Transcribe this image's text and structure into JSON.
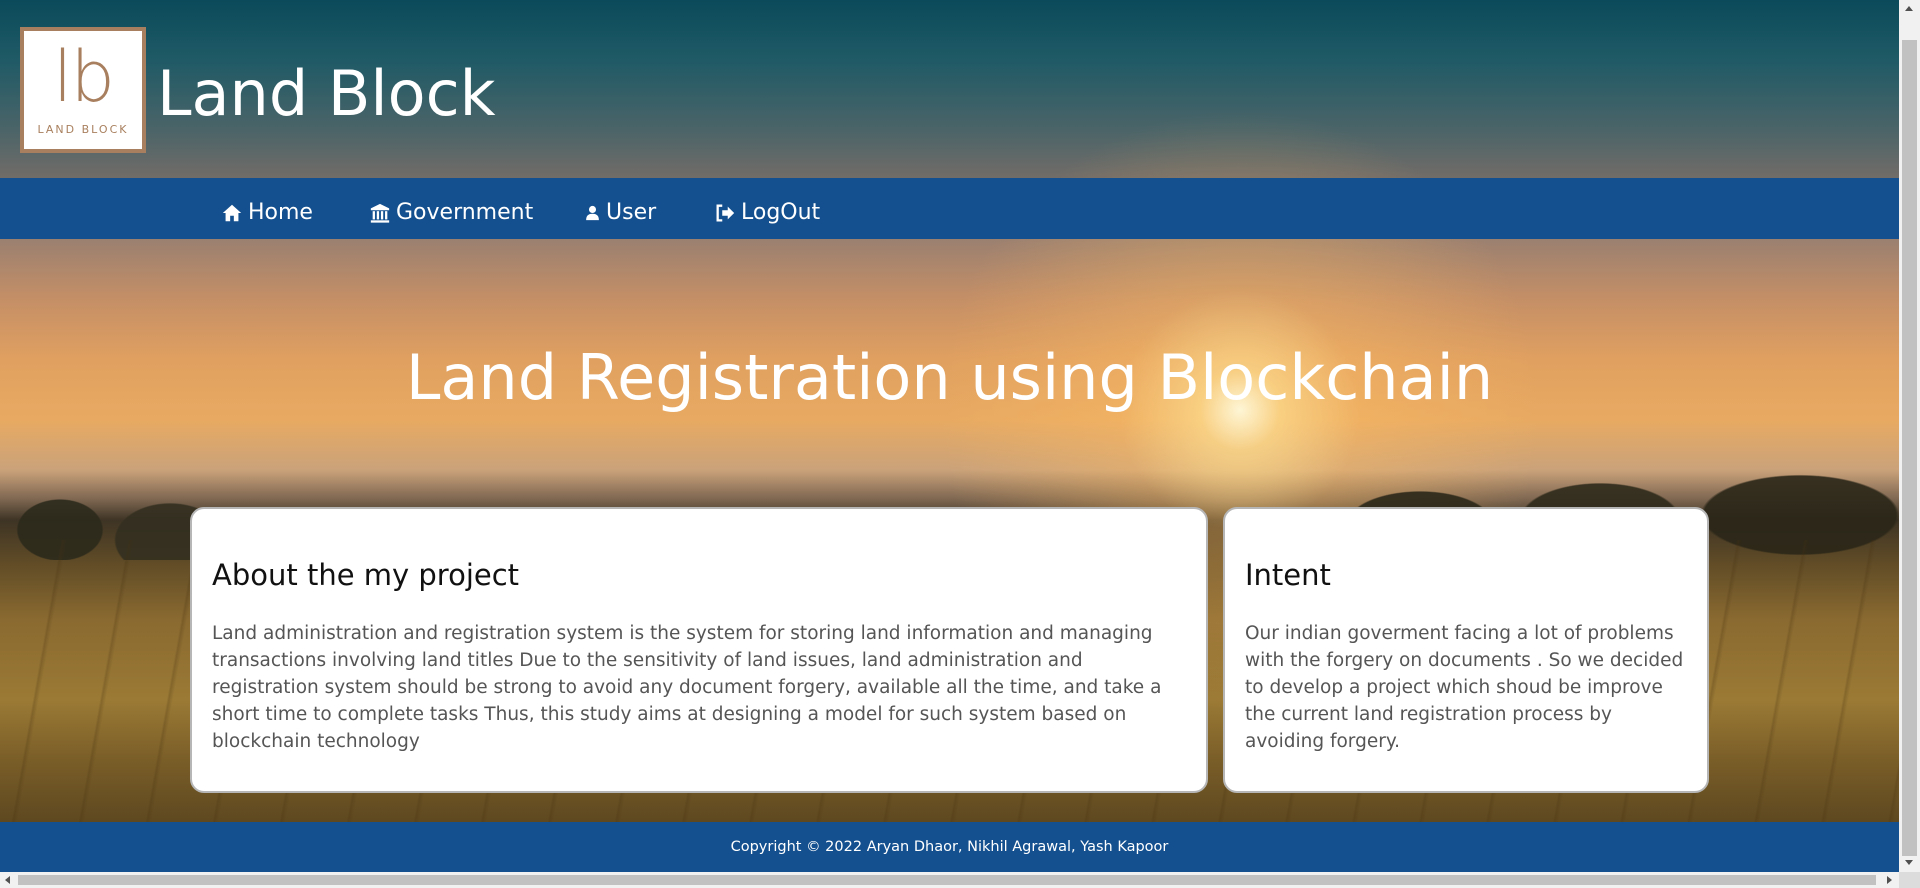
{
  "brand": {
    "logo_mark": "lb",
    "logo_sub": "LAND BLOCK",
    "site_title": "Land Block",
    "logo_border_color": "#a9805f"
  },
  "nav": {
    "background": "#14508f",
    "items": [
      {
        "label": "Home",
        "icon": "home-icon"
      },
      {
        "label": "Government",
        "icon": "bank-icon"
      },
      {
        "label": "User",
        "icon": "user-icon"
      },
      {
        "label": "LogOut",
        "icon": "logout-icon"
      }
    ]
  },
  "hero": {
    "title": "Land Registration using Blockchain"
  },
  "cards": [
    {
      "title": "About the my project",
      "body": "Land administration and registration system is the system for storing land information and managing transactions involving land titles Due to the sensitivity of land issues, land administration and registration system should be strong to avoid any document forgery, available all the time, and take a short time to complete tasks Thus, this study aims at designing a model for such system based on blockchain technology"
    },
    {
      "title": "Intent",
      "body": "Our indian goverment facing a lot of problems with the forgery on documents . So we decided to develop a project which shoud be improve the current land registration process by avoiding forgery."
    }
  ],
  "footer": {
    "copyright": "Copyright © 2022 Aryan Dhaor, Nikhil Agrawal, Yash Kapoor"
  }
}
